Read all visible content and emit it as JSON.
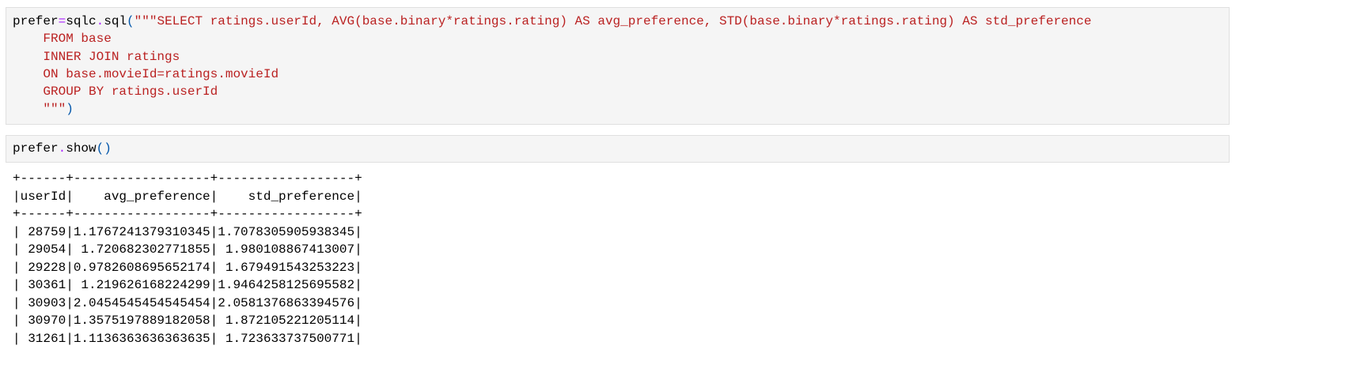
{
  "cells": [
    {
      "type": "code",
      "tokens": {
        "var": "prefer",
        "eq": "=",
        "obj": "sqlc",
        "dot": ".",
        "fn": "sql",
        "open": "(",
        "string_lines": [
          "\"\"\"SELECT ratings.userId, AVG(base.binary*ratings.rating) AS avg_preference, STD(base.binary*ratings.rating) AS std_preference",
          "    FROM base",
          "    INNER JOIN ratings",
          "    ON base.movieId=ratings.movieId",
          "    GROUP BY ratings.userId",
          "    \"\"\""
        ],
        "close": ")"
      }
    },
    {
      "type": "code",
      "tokens": {
        "var": "prefer",
        "dot": ".",
        "fn": "show",
        "parens": "()"
      }
    }
  ],
  "output": {
    "border": "+------+------------------+------------------+",
    "header": "|userId|    avg_preference|    std_preference|",
    "columns": [
      "userId",
      "avg_preference",
      "std_preference"
    ],
    "rows": [
      [
        "28759",
        "1.1767241379310345",
        "1.7078305905938345"
      ],
      [
        "29054",
        "1.720682302771855",
        "1.980108867413007"
      ],
      [
        "29228",
        "0.9782608695652174",
        "1.679491543253223"
      ],
      [
        "30361",
        "1.219626168224299",
        "1.9464258125695582"
      ],
      [
        "30903",
        "2.0454545454545454",
        "2.0581376863394576"
      ],
      [
        "30970",
        "1.3575197889182058",
        "1.872105221205114"
      ],
      [
        "31261",
        "1.1136363636363635",
        "1.723633737500771"
      ]
    ]
  },
  "colors": {
    "string": "#ba2121",
    "operator": "#aa22ff",
    "paren": "#0055aa",
    "cell_bg": "#f5f5f5"
  }
}
